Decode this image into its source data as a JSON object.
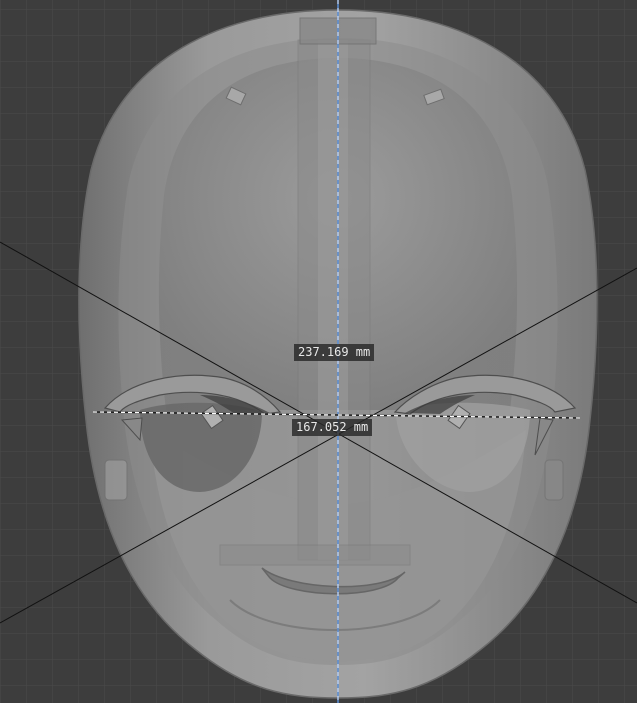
{
  "viewport": {
    "background_color": "#3d3d3d",
    "grid_minor_color": "#4a4a4a",
    "grid_major_color": "#555555",
    "model_color": "#8f8f8f",
    "axis_color": "#5a8fd8"
  },
  "measurements": {
    "vertical_label": "237.169 mm",
    "horizontal_label": "167.052 mm"
  }
}
